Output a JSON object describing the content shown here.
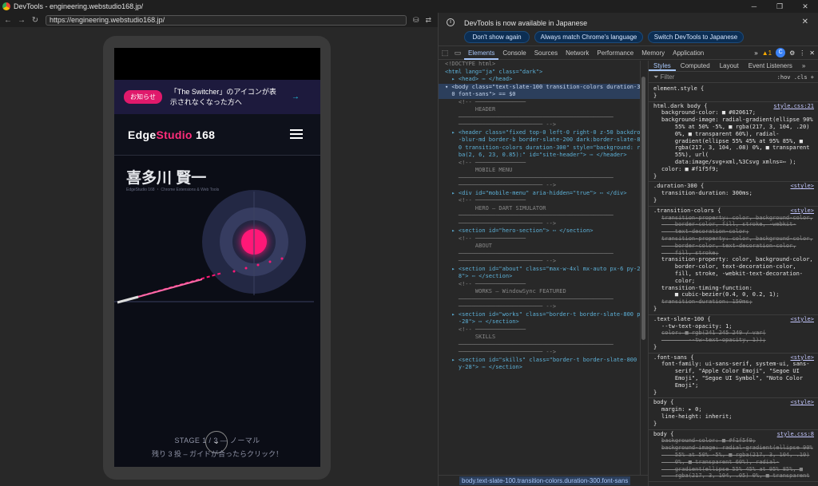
{
  "window": {
    "title": "DevTools - engineering.webstudio168.jp/"
  },
  "browser": {
    "url": "https://engineering.webstudio168.jp/"
  },
  "site": {
    "badge": "お知らせ",
    "banner_text": "「The Switcher」のアイコンが表示されなくなった方へ",
    "banner_arrow": "→",
    "brand_main": "Edge",
    "brand_accent": "Studio",
    "brand_num": " 168",
    "hero_name": "喜多川 賢一",
    "hero_sub": "EdgeStudio 168 ・ Chrome Extensions & Web Tools",
    "stage": "STAGE 1 / 3 — ノーマル",
    "remaining": "残り 3 投 – ガイドが合ったらクリック！"
  },
  "devtools": {
    "info_msg": "DevTools is now available in Japanese",
    "btn_dont_show": "Don't show again",
    "btn_match": "Always match Chrome's language",
    "btn_switch": "Switch DevTools to Japanese",
    "tabs": [
      "Elements",
      "Console",
      "Sources",
      "Network",
      "Performance",
      "Memory",
      "Application"
    ],
    "more": "»",
    "warn_count": "▲1",
    "styles_tabs": [
      "Styles",
      "Computed",
      "Layout",
      "Event Listeners",
      "»"
    ],
    "filter_placeholder": "Filter",
    "filter_tools": ":hov .cls +",
    "breadcrumb": "body.text-slate-100.transition-colors.duration-300.font-sans"
  },
  "elements_lines": [
    {
      "t": "<!DOCTYPE html>",
      "k": "cmt"
    },
    {
      "t": "<html lang=\"ja\" class=\"dark\">",
      "k": "tag",
      "pill": "view-source scroll"
    },
    {
      "t": "  ▸ <head> ⋯ </head>",
      "k": "tag"
    },
    {
      "t": "▾ <body class=\"text-slate-100 transition-colors duration-30",
      "k": "sel"
    },
    {
      "t": "  0 font-sans\"> == $0",
      "k": "sel"
    },
    {
      "t": "    <!-- ───────────────",
      "k": "cmt"
    },
    {
      "t": "",
      "k": "cmt"
    },
    {
      "t": "         HEADER",
      "k": "cmt"
    },
    {
      "t": "",
      "k": "cmt"
    },
    {
      "t": "    ──────────────────────────────────────────────",
      "k": "cmt"
    },
    {
      "t": "    ───────────────────────── -->",
      "k": "cmt"
    },
    {
      "t": "  ▸ <header class=\"fixed top-0 left-0 right-0 z-50 backdrop",
      "k": "tag"
    },
    {
      "t": "    -blur-md border-b border-slate-200 dark:border-slate-80",
      "k": "tag"
    },
    {
      "t": "    0 transition-colors duration-300\" style=\"background: rg",
      "k": "tag"
    },
    {
      "t": "    ba(2, 6, 23, 0.85):\" id=\"site-header\"> ⋯ </header>",
      "k": "tag"
    },
    {
      "t": "    <!-- ───────────────",
      "k": "cmt"
    },
    {
      "t": "",
      "k": "cmt"
    },
    {
      "t": "         MOBILE MENU",
      "k": "cmt"
    },
    {
      "t": "",
      "k": "cmt"
    },
    {
      "t": "    ──────────────────────────────────────────────",
      "k": "cmt"
    },
    {
      "t": "    ───────────────────────── -->",
      "k": "cmt"
    },
    {
      "t": "  ▸ <div id=\"mobile-menu\" aria-hidden=\"true\"> ⋯ </div>",
      "k": "tag"
    },
    {
      "t": "    <!-- ───────────────",
      "k": "cmt"
    },
    {
      "t": "",
      "k": "cmt"
    },
    {
      "t": "         HERO — DART SIMULATOR",
      "k": "cmt"
    },
    {
      "t": "",
      "k": "cmt"
    },
    {
      "t": "    ──────────────────────────────────────────────",
      "k": "cmt"
    },
    {
      "t": "    ───────────────────────── -->",
      "k": "cmt"
    },
    {
      "t": "  ▸ <section id=\"hero-section\"> ⋯ </section>",
      "k": "tag"
    },
    {
      "t": "    <!-- ───────────────",
      "k": "cmt"
    },
    {
      "t": "",
      "k": "cmt"
    },
    {
      "t": "         ABOUT",
      "k": "cmt"
    },
    {
      "t": "",
      "k": "cmt"
    },
    {
      "t": "    ──────────────────────────────────────────────",
      "k": "cmt"
    },
    {
      "t": "    ───────────────────────── -->",
      "k": "cmt"
    },
    {
      "t": "  ▸ <section id=\"about\" class=\"max-w-4xl mx-auto px-6 py-2",
      "k": "tag"
    },
    {
      "t": "    8\"> ⋯ </section>",
      "k": "tag"
    },
    {
      "t": "    <!-- ───────────────",
      "k": "cmt"
    },
    {
      "t": "",
      "k": "cmt"
    },
    {
      "t": "         WORKS — WindowSync FEATURED",
      "k": "cmt"
    },
    {
      "t": "",
      "k": "cmt"
    },
    {
      "t": "    ──────────────────────────────────────────────",
      "k": "cmt"
    },
    {
      "t": "    ───────────────────────── -->",
      "k": "cmt"
    },
    {
      "t": "  ▸ <section id=\"works\" class=\"border-t border-slate-800 py",
      "k": "tag"
    },
    {
      "t": "    -28\"> ⋯ </section>",
      "k": "tag"
    },
    {
      "t": "    <!-- ───────────────",
      "k": "cmt"
    },
    {
      "t": "",
      "k": "cmt"
    },
    {
      "t": "         SKILLS",
      "k": "cmt"
    },
    {
      "t": "",
      "k": "cmt"
    },
    {
      "t": "    ──────────────────────────────────────────────",
      "k": "cmt"
    },
    {
      "t": "    ───────────────────────── -->",
      "k": "cmt"
    },
    {
      "t": "  ▸ <section id=\"skills\" class=\"border-t border-slate-800 p",
      "k": "tag"
    },
    {
      "t": "    y-28\"> ⋯ </section>",
      "k": "tag"
    }
  ],
  "style_rules": [
    {
      "sel": "element.style {",
      "src": "",
      "decls": [
        {
          "t": "}",
          "s": false
        }
      ]
    },
    {
      "sel": "html.dark body {",
      "src": "style.css:21",
      "decls": [
        {
          "t": "background-color: ■ #020617;",
          "s": false
        },
        {
          "t": "background-image: radial-gradient(ellipse 90%",
          "s": false
        },
        {
          "t": "    55% at 50% -5%, ■ rgba(217, 3, 104, .20)",
          "s": false
        },
        {
          "t": "    0%, ■ transparent 60%), radial-",
          "s": false
        },
        {
          "t": "    gradient(ellipse 55% 45% at 95% 85%, ■",
          "s": false
        },
        {
          "t": "    rgba(217, 3, 104, .08) 0%, ■ transparent",
          "s": false
        },
        {
          "t": "    55%), url(",
          "s": false
        },
        {
          "t": "    data:image/svg+xml,%3Csvg xmlns=⋯ );",
          "s": false
        },
        {
          "t": "color: ■ #f1f5f9;",
          "s": false
        },
        {
          "t": "}",
          "s": false
        }
      ]
    },
    {
      "sel": ".duration-300 {",
      "src": "<style>",
      "decls": [
        {
          "t": "transition-duration: 300ms;",
          "s": false
        },
        {
          "t": "}",
          "s": false
        }
      ]
    },
    {
      "sel": ".transition-colors {",
      "src": "<style>",
      "decls": [
        {
          "t": "transition-property: color, background-color,",
          "s": true
        },
        {
          "t": "    border-color, fill, stroke, -webkit-",
          "s": true
        },
        {
          "t": "    text-decoration-color;",
          "s": true
        },
        {
          "t": "transition-property: color, background-color,",
          "s": true
        },
        {
          "t": "    border-color, text-decoration-color,",
          "s": true
        },
        {
          "t": "    fill, stroke;",
          "s": true
        },
        {
          "t": "transition-property: color, background-color,",
          "s": false
        },
        {
          "t": "    border-color, text-decoration-color,",
          "s": false
        },
        {
          "t": "    fill, stroke, -webkit-text-decoration-",
          "s": false
        },
        {
          "t": "    color;",
          "s": false
        },
        {
          "t": "transition-timing-function:",
          "s": false
        },
        {
          "t": "    ■ cubic-bezier(0.4, 0, 0.2, 1);",
          "s": false
        },
        {
          "t": "transition-duration: 150ms;",
          "s": true
        },
        {
          "t": "}",
          "s": false
        }
      ]
    },
    {
      "sel": ".text-slate-100 {",
      "src": "<style>",
      "decls": [
        {
          "t": "--tw-text-opacity: 1;",
          "s": false
        },
        {
          "t": "color: ■ rgb(241 245 249 / var(",
          "s": true
        },
        {
          "t": "        --tw-text-opacity, 1));",
          "s": true
        },
        {
          "t": "}",
          "s": false
        }
      ]
    },
    {
      "sel": ".font-sans {",
      "src": "<style>",
      "decls": [
        {
          "t": "font-family: ui-sans-serif, system-ui, sans-",
          "s": false
        },
        {
          "t": "    serif, \"Apple Color Emoji\", \"Segoe UI",
          "s": false
        },
        {
          "t": "    Emoji\", \"Segoe UI Symbol\", \"Noto Color",
          "s": false
        },
        {
          "t": "    Emoji\";",
          "s": false
        },
        {
          "t": "}",
          "s": false
        }
      ]
    },
    {
      "sel": "body {",
      "src": "<style>",
      "decls": [
        {
          "t": "margin: ▸ 0;",
          "s": false
        },
        {
          "t": "line-height: inherit;",
          "s": false
        },
        {
          "t": "}",
          "s": false
        }
      ]
    },
    {
      "sel": "body {",
      "src": "style.css:8",
      "decls": [
        {
          "t": "background-color: ■ #f1f5f9;",
          "s": true
        },
        {
          "t": "background-image: radial-gradient(ellipse 90%",
          "s": true
        },
        {
          "t": "    55% at 50% -5%, ■ rgba(217, 3, 104, .10)",
          "s": true
        },
        {
          "t": "    0%, ■ transparent 60%), radial-",
          "s": true
        },
        {
          "t": "    gradient(ellipse 55% 45% at 95% 85%, ■",
          "s": true
        },
        {
          "t": "    rgba(217, 3, 104, .05) 0%, ■ transparent",
          "s": true
        }
      ]
    }
  ]
}
